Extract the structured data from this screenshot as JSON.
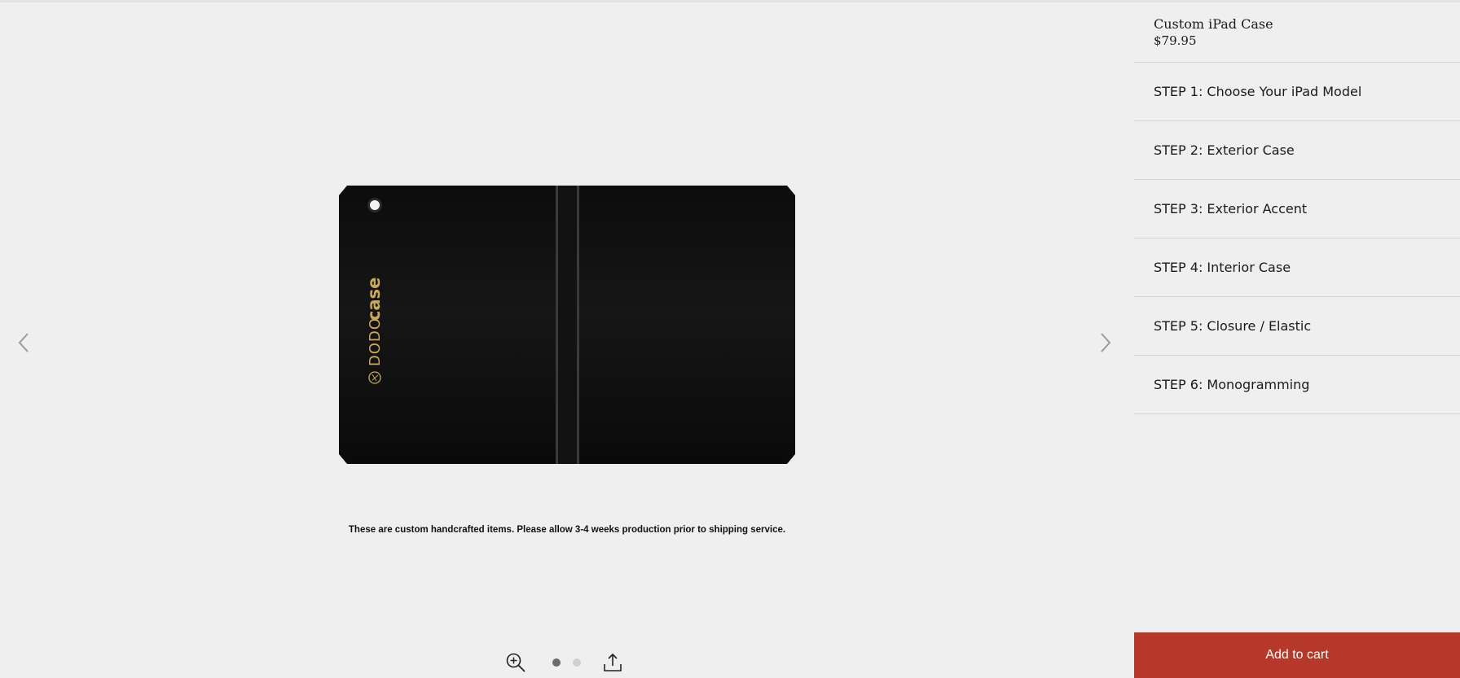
{
  "product": {
    "title": "Custom iPad Case",
    "price": "$79.95"
  },
  "gallery": {
    "notice": "These are custom handcrafted items. Please allow 3-4 weeks production prior to shipping service.",
    "prev_icon": "chevron-left-icon",
    "next_icon": "chevron-right-icon",
    "zoom_icon": "zoom-in-icon",
    "share_icon": "share-icon",
    "slide_count": 2,
    "active_slide": 1,
    "case_brand": {
      "light": "DODO",
      "bold": "case"
    }
  },
  "steps": [
    {
      "label": "STEP 1: Choose Your iPad Model"
    },
    {
      "label": "STEP 2: Exterior Case"
    },
    {
      "label": "STEP 3: Exterior Accent"
    },
    {
      "label": "STEP 4: Interior Case"
    },
    {
      "label": "STEP 5: Closure / Elastic"
    },
    {
      "label": "STEP 6: Monogramming"
    }
  ],
  "cart": {
    "label": "Add to cart"
  },
  "colors": {
    "accent": "#b5382a",
    "background": "#efefef",
    "case_body": "#141414",
    "brand_gold": "#c9a85a"
  }
}
